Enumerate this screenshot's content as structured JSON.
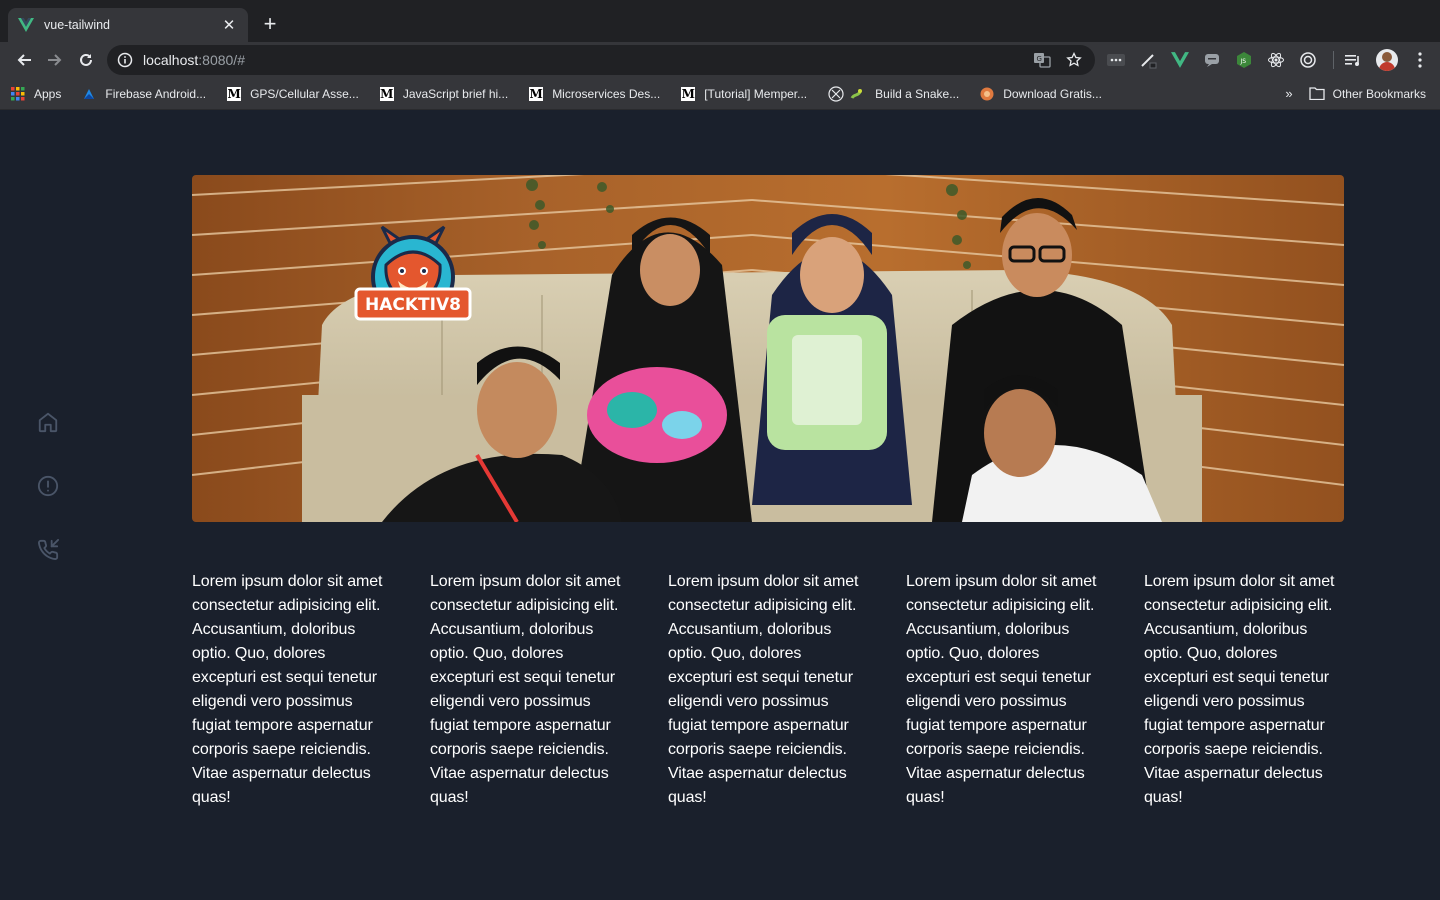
{
  "browser": {
    "tab_title": "vue-tailwind",
    "url_host": "localhost",
    "url_rest": ":8080/#",
    "bookmarks": [
      {
        "label": "Apps",
        "icon": "apps-grid-icon"
      },
      {
        "label": "Firebase Android...",
        "icon": "firebase-icon"
      },
      {
        "label": "GPS/Cellular Asse...",
        "icon": "medium-icon"
      },
      {
        "label": "JavaScript brief hi...",
        "icon": "medium-icon"
      },
      {
        "label": "Microservices Des...",
        "icon": "medium-icon"
      },
      {
        "label": "[Tutorial] Memper...",
        "icon": "medium-icon"
      },
      {
        "label": "Build a Snake...",
        "icon": "snake-icon"
      },
      {
        "label": "Download Gratis...",
        "icon": "download-site-icon"
      }
    ],
    "bookmarks_more": "»",
    "other_bookmarks": "Other Bookmarks",
    "theme_color": "#202124",
    "accent_vue": "#41b883"
  },
  "page": {
    "background": "#1a202c",
    "sidebar": {
      "items": [
        {
          "name": "home-icon"
        },
        {
          "name": "alert-circle-icon"
        },
        {
          "name": "phone-incoming-icon"
        }
      ]
    },
    "banner": {
      "logo_text": "HACKTIV8"
    },
    "columns": [
      {
        "text": "Lorem ipsum dolor sit amet consectetur adipisicing elit. Accusantium, doloribus optio. Quo, dolores excepturi est sequi tenetur eligendi vero possimus fugiat tempore aspernatur corporis saepe reiciendis. Vitae aspernatur delectus quas!"
      },
      {
        "text": "Lorem ipsum dolor sit amet consectetur adipisicing elit. Accusantium, doloribus optio. Quo, dolores excepturi est sequi tenetur eligendi vero possimus fugiat tempore aspernatur corporis saepe reiciendis. Vitae aspernatur delectus quas!"
      },
      {
        "text": "Lorem ipsum dolor sit amet consectetur adipisicing elit. Accusantium, doloribus optio. Quo, dolores excepturi est sequi tenetur eligendi vero possimus fugiat tempore aspernatur corporis saepe reiciendis. Vitae aspernatur delectus quas!"
      },
      {
        "text": "Lorem ipsum dolor sit amet consectetur adipisicing elit. Accusantium, doloribus optio. Quo, dolores excepturi est sequi tenetur eligendi vero possimus fugiat tempore aspernatur corporis saepe reiciendis. Vitae aspernatur delectus quas!"
      },
      {
        "text": "Lorem ipsum dolor sit amet consectetur adipisicing elit. Accusantium, doloribus optio. Quo, dolores excepturi est sequi tenetur eligendi vero possimus fugiat tempore aspernatur corporis saepe reiciendis. Vitae aspernatur delectus quas!"
      }
    ]
  }
}
